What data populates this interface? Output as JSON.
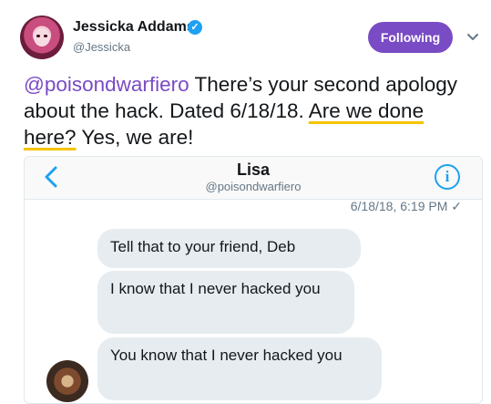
{
  "author": {
    "name": "Jessicka Addams",
    "handle": "@Jessicka",
    "verified_icon": "verified-badge-icon"
  },
  "actions": {
    "follow_label": "Following",
    "follow_color": "#794bc4",
    "menu_icon": "chevron-down-icon"
  },
  "tweet": {
    "mention": "@poisondwarfiero",
    "text_part1": " There’s your second apology about the hack. Dated 6/18/18. ",
    "highlight": "Are we done here?",
    "text_part2": " Yes, we are!",
    "mention_color": "#794bc4",
    "highlight_color": "#f5c400"
  },
  "dm": {
    "contact_name": "Lisa",
    "contact_handle": "@poisondwarfiero",
    "timestamp": "6/18/18, 6:19 PM ✓",
    "messages": [
      "Tell that to your friend, Deb",
      "I know that I never hacked you",
      "You know that I never hacked you"
    ]
  }
}
